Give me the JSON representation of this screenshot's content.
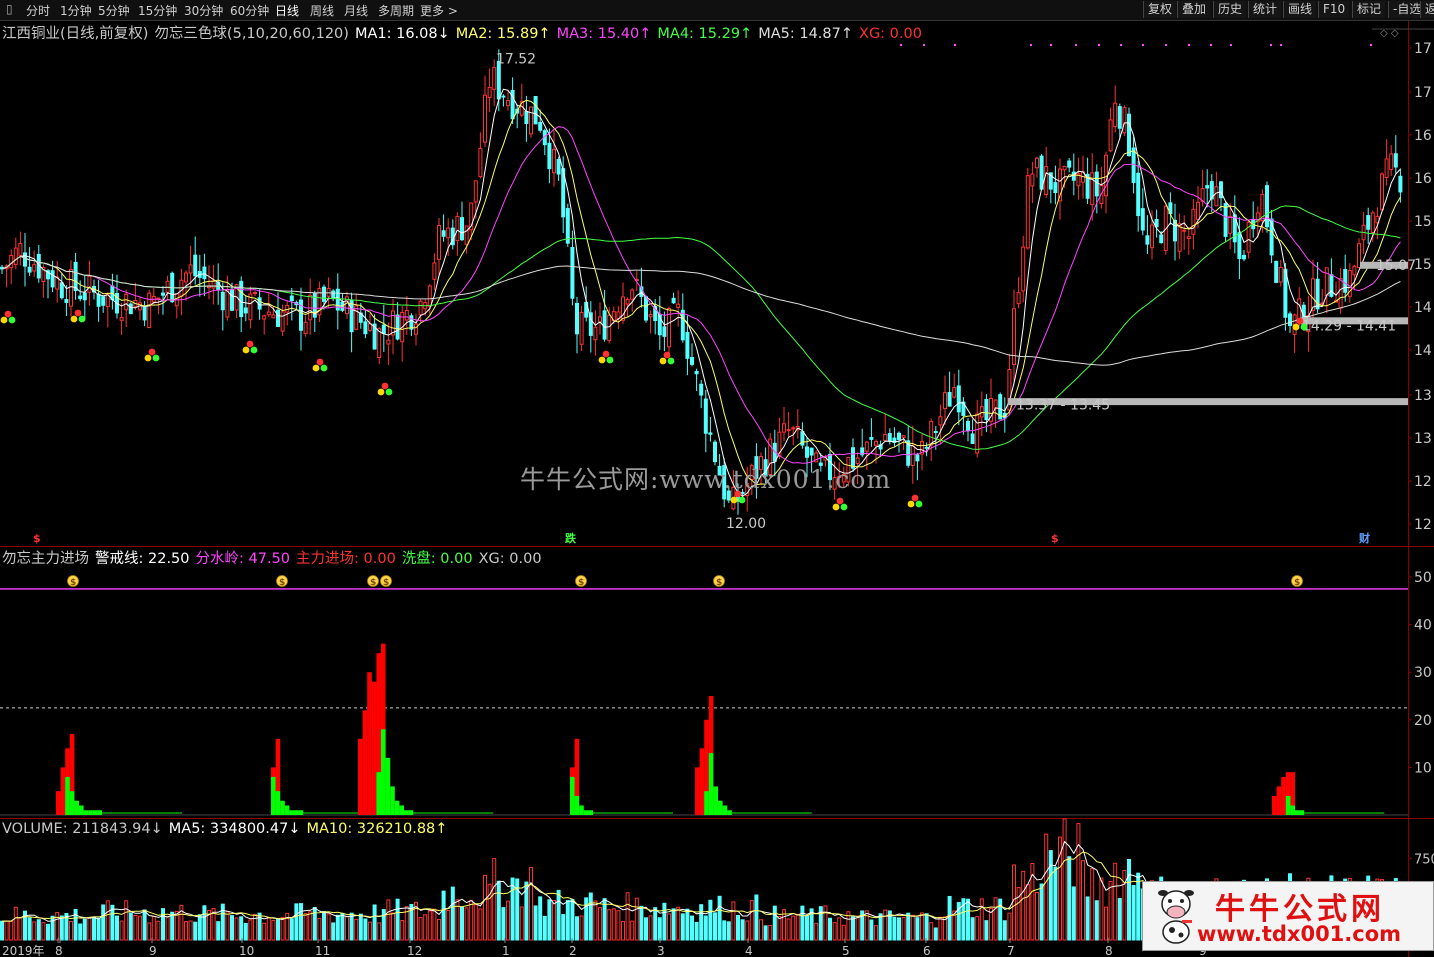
{
  "toolbar": {
    "left": [
      "分时",
      "1分钟",
      "5分钟",
      "15分钟",
      "30分钟",
      "60分钟",
      "日线",
      "周线",
      "月线",
      "多周期",
      "更多 >"
    ],
    "active": "日线",
    "right": [
      "复权",
      "叠加",
      "历史",
      "统计",
      "画线",
      "F10",
      "标记",
      "-自选",
      "返"
    ]
  },
  "main_legend": {
    "stock": "江西铜业(日线,前复权)",
    "indicator": "勿忘三色球(5,10,20,60,120)",
    "ma1": "MA1: 16.08↓",
    "ma2": "MA2: 15.89↑",
    "ma3": "MA3: 15.40↑",
    "ma4": "MA4: 15.29↑",
    "ma5": "MA5: 14.87↑",
    "xg": "XG: 0.00"
  },
  "ind_legend": {
    "name": "勿忘主力进场",
    "warn": "警戒线: 22.50",
    "fsl": "分水岭: 47.50",
    "zljc": "主力进场: 0.00",
    "xp": "洗盘: 0.00",
    "xg": "XG: 0.00"
  },
  "vol_legend": {
    "vol": "VOLUME: 211843.94↓",
    "ma5": "MA5: 334800.47↓",
    "ma10": "MA10: 326210.88↑"
  },
  "colors": {
    "up": "#ff3232",
    "down": "#54ffff",
    "ma1": "#ffffff",
    "ma2": "#ffff66",
    "ma3": "#ff44ff",
    "ma4": "#44ff44",
    "ma5": "#dddddd",
    "fsl": "#ff44ff",
    "red_bar": "#ff0000",
    "green_bar": "#00ff00"
  },
  "chart_data": [
    {
      "type": "candlestick",
      "title": "江西铜业(日线,前复权)",
      "y_axis_labels": [
        "17",
        "17",
        "16",
        "16",
        "15",
        "15",
        "14",
        "14",
        "13",
        "13",
        "12",
        "12"
      ],
      "ylim": [
        11.8,
        17.8
      ],
      "annotations": [
        {
          "text": "17.52",
          "x": 490,
          "price": 17.52
        },
        {
          "text": "12.00",
          "x": 720,
          "price": 12.0
        },
        {
          "text": "13.37 - 13.45",
          "x": 1010,
          "price": 13.41
        },
        {
          "text": "14.29 - 14.41",
          "x": 1296,
          "price": 14.35
        },
        {
          "text": "15.07",
          "x": 1370,
          "price": 15.07
        }
      ],
      "support_zones": [
        {
          "label": "13.37 - 13.45",
          "low": 13.37,
          "high": 13.45
        },
        {
          "label": "14.29 - 14.41",
          "low": 14.29,
          "high": 14.41
        },
        {
          "label": "15.07",
          "low": 15.0,
          "high": 15.07
        }
      ],
      "bottom_markers": [
        {
          "text": "$",
          "x": 38,
          "color": "#ff3232"
        },
        {
          "text": "跌",
          "x": 570,
          "color": "#44ff44"
        },
        {
          "text": "$",
          "x": 1056,
          "color": "#ff3232"
        },
        {
          "text": "财",
          "x": 1364,
          "color": "#5f9fff"
        }
      ],
      "key_points": [
        {
          "x": 0,
          "close": 15.0
        },
        {
          "x": 20,
          "close": 15.25
        },
        {
          "x": 60,
          "close": 14.85
        },
        {
          "x": 100,
          "close": 14.7
        },
        {
          "x": 150,
          "close": 14.6
        },
        {
          "x": 190,
          "close": 15.0
        },
        {
          "x": 240,
          "close": 14.6
        },
        {
          "x": 300,
          "close": 14.45
        },
        {
          "x": 330,
          "close": 14.65
        },
        {
          "x": 380,
          "close": 14.25
        },
        {
          "x": 420,
          "close": 14.6
        },
        {
          "x": 440,
          "close": 15.4
        },
        {
          "x": 470,
          "close": 15.6
        },
        {
          "x": 490,
          "close": 17.3
        },
        {
          "x": 510,
          "close": 17.05
        },
        {
          "x": 540,
          "close": 16.8
        },
        {
          "x": 560,
          "close": 16.0
        },
        {
          "x": 575,
          "close": 14.3
        },
        {
          "x": 600,
          "close": 14.3
        },
        {
          "x": 630,
          "close": 14.9
        },
        {
          "x": 660,
          "close": 14.2
        },
        {
          "x": 680,
          "close": 14.5
        },
        {
          "x": 700,
          "close": 13.5
        },
        {
          "x": 730,
          "close": 12.15
        },
        {
          "x": 760,
          "close": 12.7
        },
        {
          "x": 790,
          "close": 13.1
        },
        {
          "x": 820,
          "close": 12.55
        },
        {
          "x": 860,
          "close": 12.8
        },
        {
          "x": 885,
          "close": 13.05
        },
        {
          "x": 920,
          "close": 12.75
        },
        {
          "x": 955,
          "close": 13.65
        },
        {
          "x": 975,
          "close": 13.1
        },
        {
          "x": 1005,
          "close": 13.4
        },
        {
          "x": 1030,
          "close": 16.2
        },
        {
          "x": 1060,
          "close": 16.0
        },
        {
          "x": 1080,
          "close": 16.1
        },
        {
          "x": 1100,
          "close": 15.9
        },
        {
          "x": 1115,
          "close": 17.1
        },
        {
          "x": 1130,
          "close": 16.5
        },
        {
          "x": 1145,
          "close": 15.2
        },
        {
          "x": 1165,
          "close": 15.6
        },
        {
          "x": 1190,
          "close": 15.4
        },
        {
          "x": 1210,
          "close": 16.1
        },
        {
          "x": 1240,
          "close": 15.1
        },
        {
          "x": 1260,
          "close": 16.0
        },
        {
          "x": 1290,
          "close": 14.3
        },
        {
          "x": 1320,
          "close": 14.8
        },
        {
          "x": 1350,
          "close": 14.9
        },
        {
          "x": 1375,
          "close": 15.8
        },
        {
          "x": 1390,
          "close": 16.2
        },
        {
          "x": 1405,
          "close": 16.1
        }
      ]
    },
    {
      "type": "bar",
      "title": "勿忘主力进场",
      "y_axis_labels": [
        "50",
        "40",
        "30",
        "20",
        "10"
      ],
      "ylim": [
        0,
        52
      ],
      "warning_line": 22.5,
      "watershed_line": 47.5,
      "clusters": [
        {
          "x": 56,
          "red": [
            5,
            10,
            14,
            17
          ],
          "green": [
            8,
            5,
            3,
            2,
            1,
            1,
            1,
            1
          ]
        },
        {
          "x": 271,
          "red": [
            10,
            16
          ],
          "green": [
            8,
            5,
            3,
            2,
            1,
            1,
            1
          ]
        },
        {
          "x": 358,
          "red": [
            16,
            22,
            30,
            28,
            34,
            36
          ],
          "green": [
            9,
            18,
            12,
            6,
            3,
            2,
            1,
            1
          ]
        },
        {
          "x": 570,
          "red": [
            10,
            16
          ],
          "green": [
            8,
            4,
            2,
            1,
            1
          ]
        },
        {
          "x": 695,
          "red": [
            10,
            14,
            20,
            25
          ],
          "green": [
            5,
            13,
            6,
            3,
            2,
            1
          ]
        },
        {
          "x": 1272,
          "red": [
            4,
            6,
            8,
            9,
            9
          ],
          "green": [
            4,
            2,
            1,
            1
          ]
        }
      ],
      "money_markers": [
        73,
        282,
        373,
        386,
        581,
        719,
        1297
      ]
    },
    {
      "type": "bar",
      "title": "VOLUME",
      "y_axis_labels": [
        "750"
      ],
      "x_axis_labels": [
        "2019年",
        "8",
        "9",
        "10",
        "11",
        "12",
        "1",
        "2",
        "3",
        "4",
        "5",
        "6",
        "7",
        "8",
        "9"
      ],
      "ylim": [
        0,
        900000
      ],
      "volume_regions": [
        {
          "x": 0,
          "level": 220000
        },
        {
          "x": 100,
          "level": 250000
        },
        {
          "x": 200,
          "level": 230000
        },
        {
          "x": 300,
          "level": 240000
        },
        {
          "x": 380,
          "level": 260000
        },
        {
          "x": 440,
          "level": 430000
        },
        {
          "x": 490,
          "level": 520000
        },
        {
          "x": 540,
          "level": 330000
        },
        {
          "x": 600,
          "level": 300000
        },
        {
          "x": 680,
          "level": 290000
        },
        {
          "x": 760,
          "level": 220000
        },
        {
          "x": 850,
          "level": 200000
        },
        {
          "x": 940,
          "level": 300000
        },
        {
          "x": 1010,
          "level": 560000
        },
        {
          "x": 1040,
          "level": 780000
        },
        {
          "x": 1080,
          "level": 520000
        },
        {
          "x": 1115,
          "level": 640000
        },
        {
          "x": 1145,
          "level": 420000
        }
      ]
    }
  ],
  "watermark": {
    "center": "牛牛公式网:www.tdx001.com",
    "box_title": "牛牛公式网",
    "box_url": "www.tdx001.com"
  }
}
